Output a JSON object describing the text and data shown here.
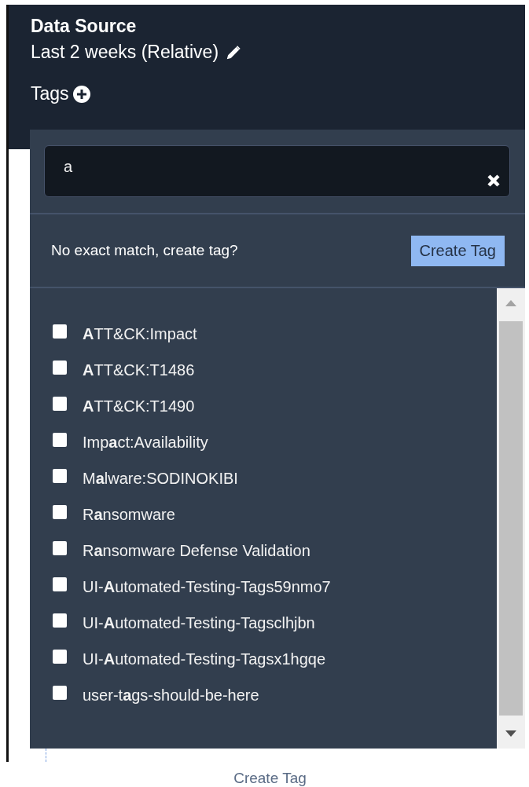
{
  "header": {
    "title": "Data Source",
    "range": "Last 2 weeks (Relative)",
    "tags_label": "Tags"
  },
  "tag_picker": {
    "search": {
      "value": "a"
    },
    "prompt": "No exact match, create tag?",
    "create_button": "Create Tag",
    "options": [
      {
        "label": "**A**TT&CK:Impact",
        "checked": false
      },
      {
        "label": "**A**TT&CK:T1486",
        "checked": false
      },
      {
        "label": "**A**TT&CK:T1490",
        "checked": false
      },
      {
        "label": "Imp**a**ct:Availability",
        "checked": false
      },
      {
        "label": "M**a**lware:SODINOKIBI",
        "checked": false
      },
      {
        "label": "R**a**nsomware",
        "checked": false
      },
      {
        "label": "R**a**nsomware Defense Validation",
        "checked": false
      },
      {
        "label": "UI-**A**utomated-Testing-Tags59nmo7",
        "checked": false
      },
      {
        "label": "UI-**A**utomated-Testing-Tagsclhjbn",
        "checked": false
      },
      {
        "label": "UI-**A**utomated-Testing-Tagsx1hgqe",
        "checked": false
      },
      {
        "label": "user-t**a**gs-should-be-here",
        "checked": false
      }
    ]
  },
  "footer_link": "Create Tag"
}
